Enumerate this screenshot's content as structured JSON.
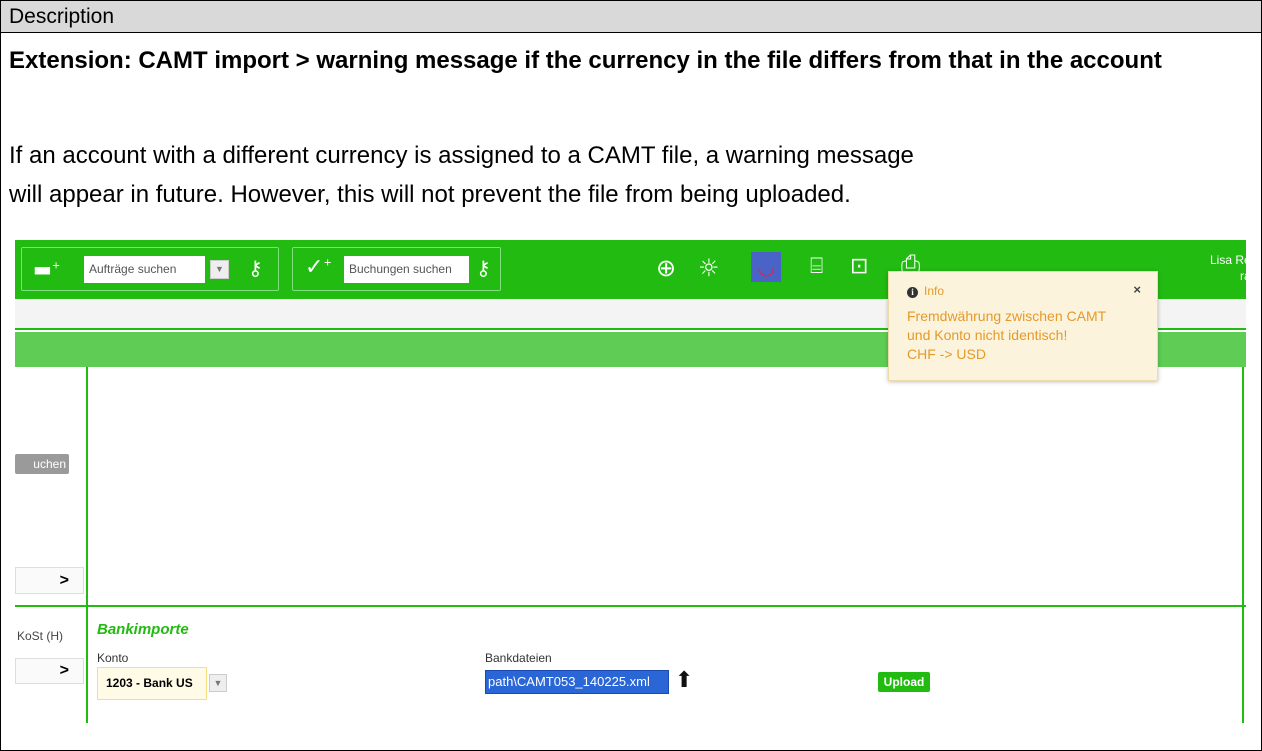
{
  "doc": {
    "section_label": "Description",
    "title": "Extension: CAMT import > warning message if the currency in the file differs from that in the account",
    "body_line1": "If an account with a different currency is assigned to a CAMT file, a warning message",
    "body_line2": "will appear in future. However, this will not prevent the file from being uploaded."
  },
  "app": {
    "search_orders_placeholder": "Aufträge suchen",
    "search_bookings_placeholder": "Buchungen suchen",
    "user_name": "Lisa Reiche",
    "user_line2": "ral",
    "icons": [
      "card-plus-icon",
      "key-icon",
      "check-plus-icon",
      "globe-icon",
      "sun-icon",
      "tui-logo-icon",
      "chat-icon",
      "printer-icon",
      "chart-icon",
      "settings-icon",
      "power-icon",
      "exit-icon"
    ],
    "brand_color": "#22bb11"
  },
  "sidebar": {
    "suchen_label": "uchen",
    "nav_arrow": ">",
    "kost_label": "KoSt (H)"
  },
  "bankimporte": {
    "section_title": "Bankimporte",
    "konto_label": "Konto",
    "konto_value": "1203 - Bank US",
    "bankdateien_label": "Bankdateien",
    "file_value": "path\\CAMT053_140225.xml",
    "upload_label": "Upload"
  },
  "toast": {
    "heading": "Info",
    "close": "×",
    "line1": "Fremdwährung zwischen CAMT",
    "line2": "und Konto nicht identisch!",
    "line3": "CHF -> USD"
  }
}
